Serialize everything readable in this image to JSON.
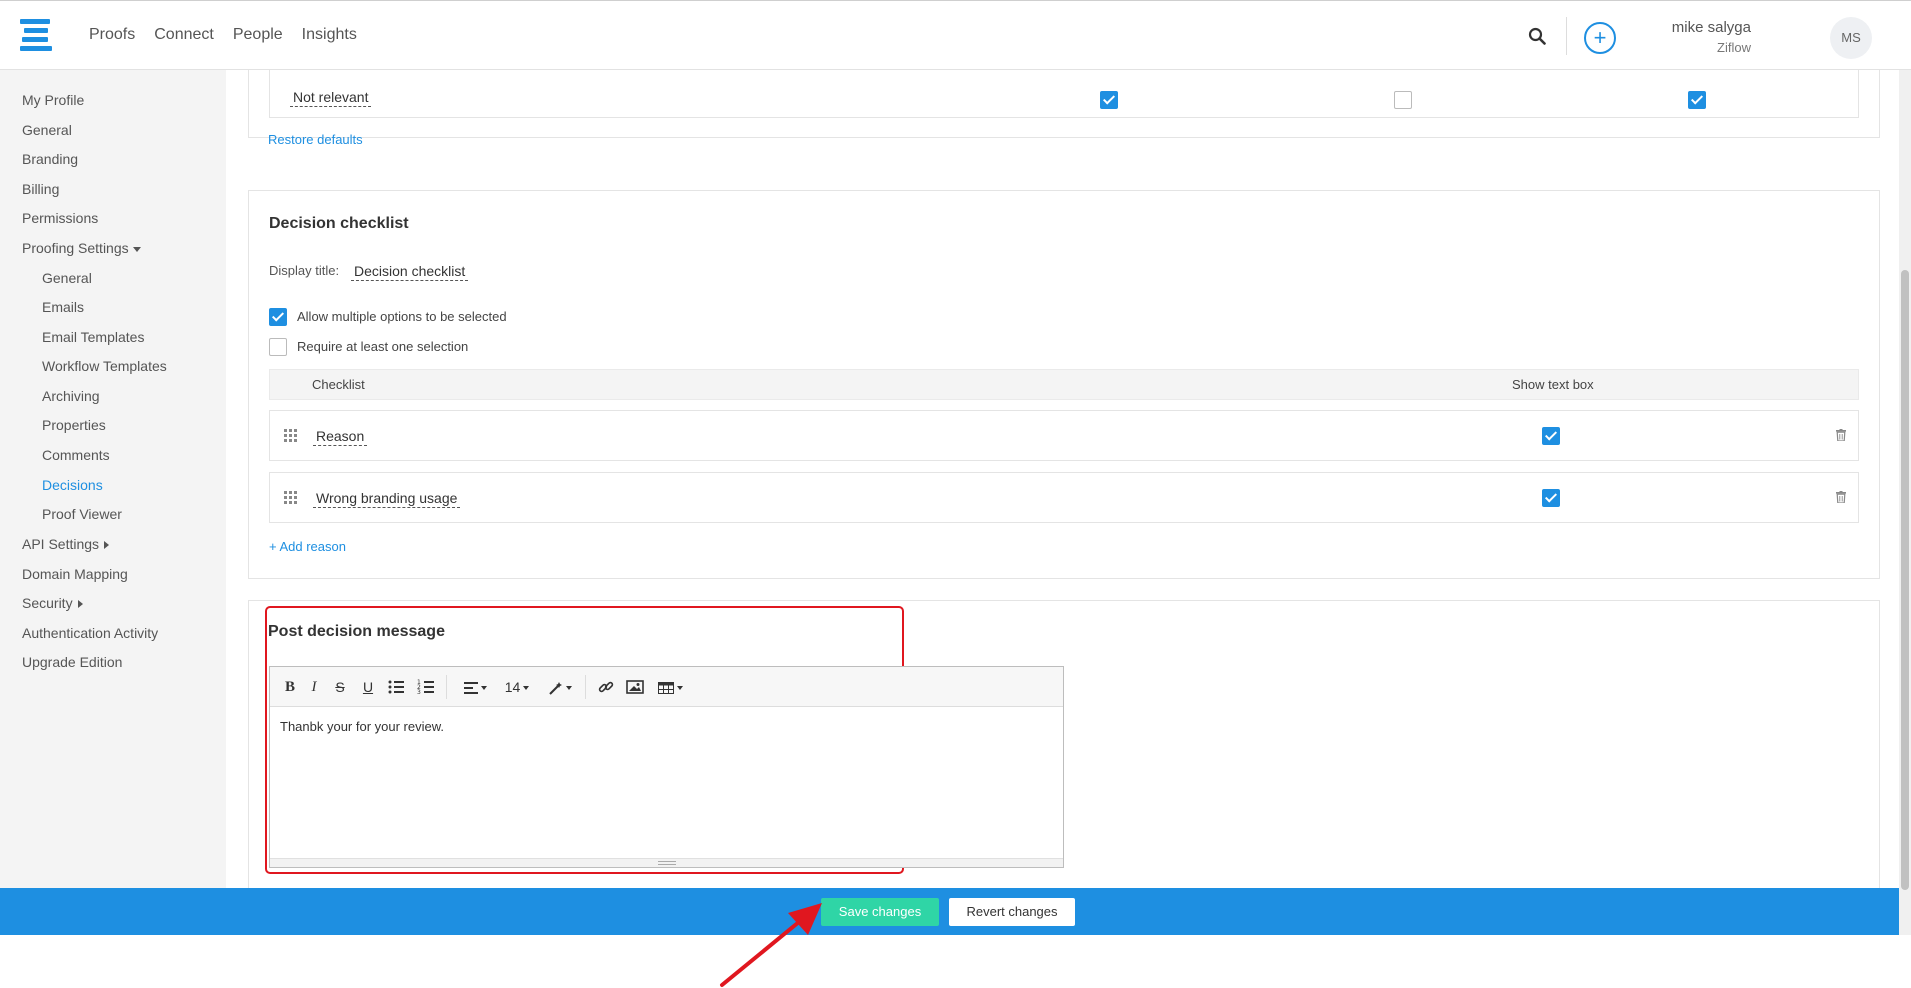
{
  "nav": {
    "links": [
      "Proofs",
      "Connect",
      "People",
      "Insights"
    ],
    "user_name": "mike salyga",
    "user_org": "Ziflow",
    "avatar_initials": "MS"
  },
  "sidebar": {
    "items": [
      {
        "label": "My Profile"
      },
      {
        "label": "General"
      },
      {
        "label": "Branding"
      },
      {
        "label": "Billing"
      },
      {
        "label": "Permissions"
      },
      {
        "label": "Proofing Settings"
      },
      {
        "label": "General"
      },
      {
        "label": "Emails"
      },
      {
        "label": "Email Templates"
      },
      {
        "label": "Workflow Templates"
      },
      {
        "label": "Archiving"
      },
      {
        "label": "Properties"
      },
      {
        "label": "Comments"
      },
      {
        "label": "Decisions"
      },
      {
        "label": "Proof Viewer"
      },
      {
        "label": "API Settings"
      },
      {
        "label": "Domain Mapping"
      },
      {
        "label": "Security"
      },
      {
        "label": "Authentication Activity"
      },
      {
        "label": "Upgrade Edition"
      }
    ]
  },
  "decisions_top": {
    "row_label": "Not relevant",
    "checkboxes": [
      true,
      false,
      true
    ],
    "restore_link": "Restore defaults"
  },
  "checklist": {
    "title": "Decision checklist",
    "display_title_label": "Display title:",
    "display_title_value": "Decision checklist",
    "allow_multiple_label": "Allow multiple options to be selected",
    "allow_multiple_checked": true,
    "require_one_label": "Require at least one selection",
    "require_one_checked": false,
    "col_checklist": "Checklist",
    "col_show_text": "Show text box",
    "items": [
      {
        "label": "Reason",
        "show_text_box": true
      },
      {
        "label": "Wrong branding usage",
        "show_text_box": true
      }
    ],
    "add_link": "+ Add reason"
  },
  "post_decision": {
    "title": "Post decision message",
    "font_size": "14",
    "content": "Thanbk your for your review."
  },
  "footer": {
    "save_label": "Save changes",
    "revert_label": "Revert changes"
  },
  "colors": {
    "accent": "#1e8fe1",
    "save": "#2fd5a6",
    "highlight": "#e0171f"
  }
}
